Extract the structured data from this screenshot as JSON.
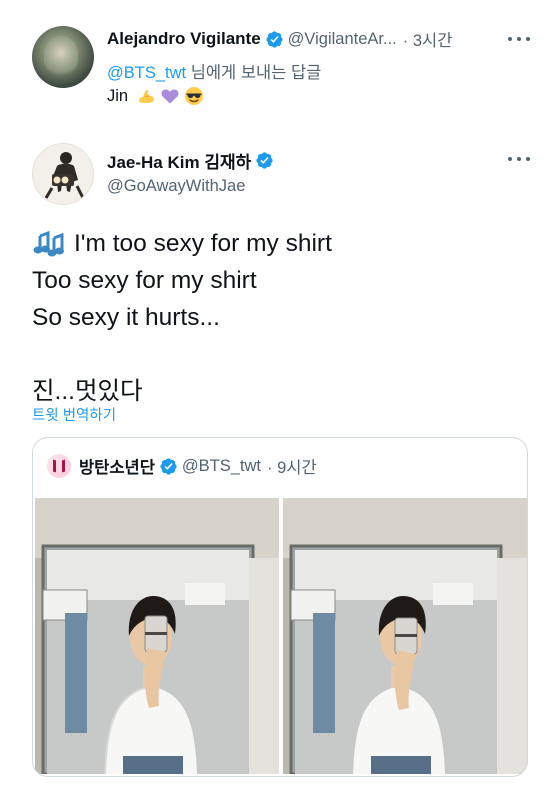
{
  "reply_tweet": {
    "author_name": "Alejandro Vigilante",
    "author_handle": "@VigilanteAr...",
    "time": "· 3시간",
    "replying_mention": "@BTS_twt",
    "replying_suffix": " 님에게 보내는 답글",
    "text": "Jin",
    "emojis": [
      "flexed-biceps-emoji",
      "purple-heart-emoji",
      "sunglasses-face-emoji"
    ]
  },
  "main_tweet": {
    "author_name": "Jae-Ha Kim 김재하",
    "author_handle": "@GoAwayWithJae",
    "lines": [
      "I'm too sexy for my shirt",
      "Too sexy for my shirt",
      "So sexy it hurts...",
      "",
      "진...멋있다"
    ],
    "translate_label": "트윗 번역하기"
  },
  "quote_tweet": {
    "author_name": "방탄소년단",
    "author_handle": "@BTS_twt",
    "time": "· 9시간",
    "photos": [
      "mirror-selfie-photo-1",
      "mirror-selfie-photo-2"
    ]
  },
  "colors": {
    "accent": "#1d9bf0",
    "text": "#0f1419",
    "secondary": "#536471",
    "border": "#cfd9de"
  }
}
